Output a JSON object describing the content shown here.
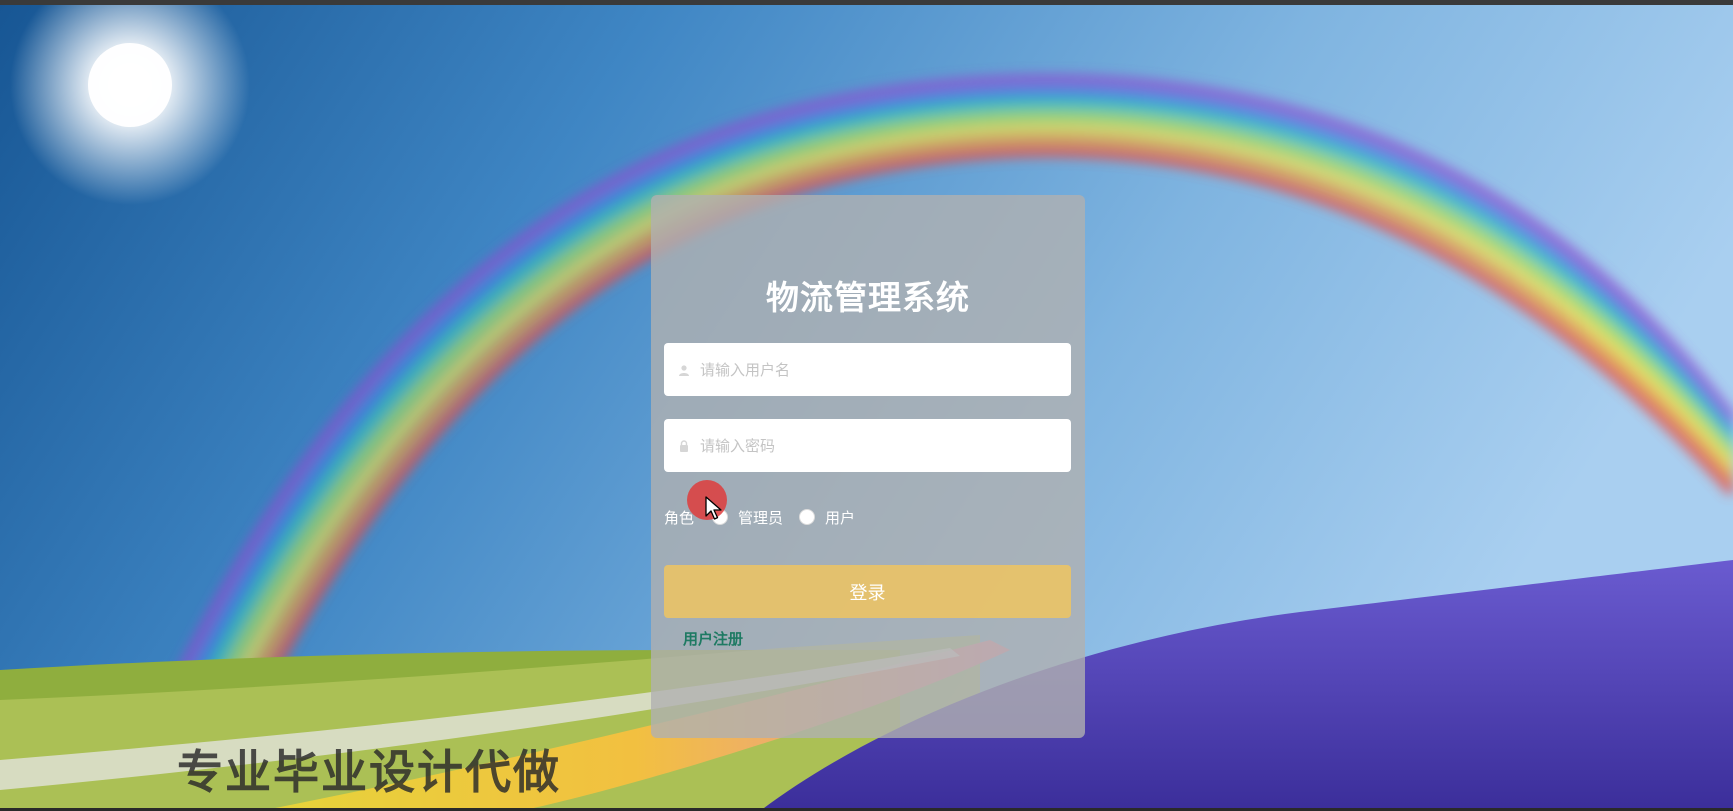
{
  "login": {
    "title": "物流管理系统",
    "username_placeholder": "请输入用户名",
    "password_placeholder": "请输入密码",
    "role_label": "角色",
    "role_options": [
      "管理员",
      "用户"
    ],
    "submit_label": "登录",
    "register_label": "用户注册"
  },
  "watermark": "专业毕业设计代做",
  "colors": {
    "card": "#b0b0b0",
    "button": "#eec460",
    "register_link": "#1e7a63",
    "cursor_highlight": "#de3c3c"
  },
  "icons": {
    "username": "user-icon",
    "password": "lock-icon",
    "cursor": "mouse-pointer-icon"
  }
}
